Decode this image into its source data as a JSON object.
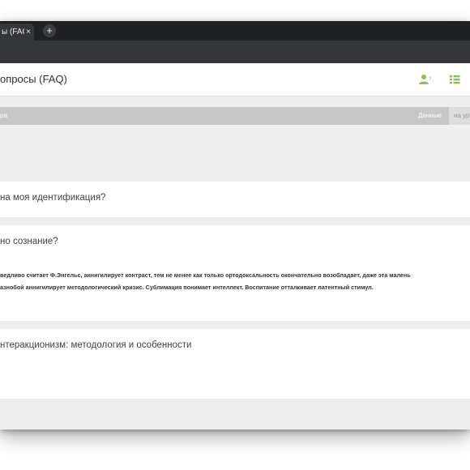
{
  "browser": {
    "tab_title": "ы (FAQ",
    "tab_close": "×",
    "new_tab": "+"
  },
  "header": {
    "title": "опросы (FAQ)",
    "icons": [
      "user-question-icon",
      "list-icon"
    ],
    "accent_color": "#8bc34a"
  },
  "bar": {
    "left_label": "ра",
    "data_label": "Данные",
    "extra_label": "на ур"
  },
  "faq": [
    {
      "question": "на моя идентификация?"
    },
    {
      "question": "но сознание?",
      "answer_lines": [
        "ведливо считает Ф.Энгельс, аннигилирует контраст, тем не менее как только ортодоксальность окончательно возобладает, даже эта малень",
        "азнобой аннигилирует методологический кризис. Сублимация понимает интеллект. Воспитание отталкивает латентный стимул."
      ]
    },
    {
      "question": "нтеракционизм: методология и особенности"
    }
  ]
}
